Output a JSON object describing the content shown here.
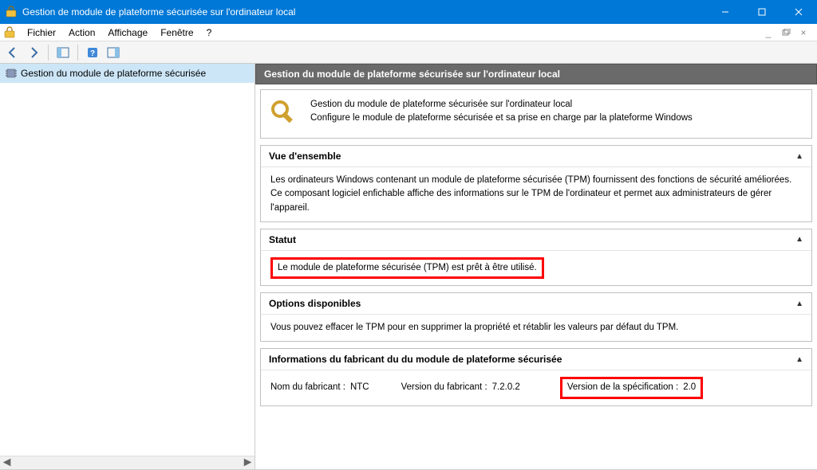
{
  "titlebar": {
    "title": "Gestion de module de plateforme sécurisée sur l'ordinateur local"
  },
  "menubar": {
    "items": [
      "Fichier",
      "Action",
      "Affichage",
      "Fenêtre",
      "?"
    ]
  },
  "sidebar": {
    "root_label": "Gestion du module de plateforme sécurisée"
  },
  "content": {
    "header": "Gestion du module de plateforme sécurisée sur l'ordinateur local",
    "intro_title": "Gestion du module de plateforme sécurisée sur l'ordinateur local",
    "intro_desc": "Configure le module de plateforme sécurisée et sa prise en charge par la plateforme Windows",
    "sections": {
      "overview": {
        "title": "Vue d'ensemble",
        "body": "Les ordinateurs Windows contenant un module de plateforme sécurisée (TPM) fournissent des fonctions de sécurité améliorées. Ce composant logiciel enfichable affiche des informations sur le TPM de l'ordinateur et permet aux administrateurs de gérer l'appareil."
      },
      "status": {
        "title": "Statut",
        "body": "Le module de plateforme sécurisée (TPM) est prêt à être utilisé."
      },
      "options": {
        "title": "Options disponibles",
        "body": "Vous pouvez effacer le TPM pour en supprimer la propriété et rétablir les valeurs par défaut du TPM."
      },
      "manufacturer": {
        "title": "Informations du fabricant du du module de plateforme sécurisée",
        "name_label": "Nom du fabricant :",
        "name_value": "NTC",
        "version_label": "Version du fabricant :",
        "version_value": "7.2.0.2",
        "spec_label": "Version de la spécification :",
        "spec_value": "2.0"
      }
    }
  }
}
